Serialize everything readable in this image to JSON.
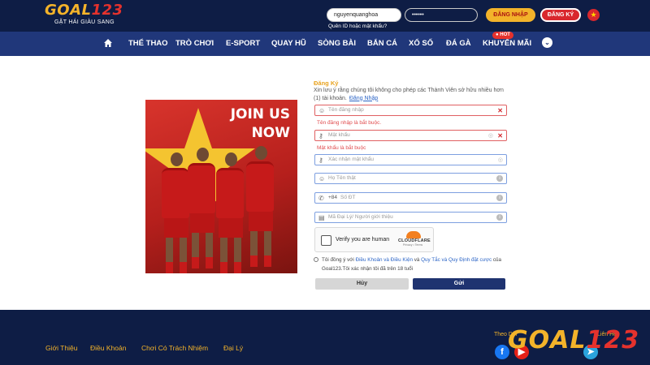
{
  "header": {
    "logo_text_a": "GOAL",
    "logo_text_b": "123",
    "logo_tagline": "GẶT HÁI GIÀU SANG",
    "username_value": "nguyenquanghoa",
    "password_value": "••••••",
    "forgot_label": "Quên ID hoặc mật khẩu?",
    "login_label": "ĐĂNG NHẬP",
    "register_label": "ĐĂNG KÝ",
    "flag_icon": "vietnam-flag-icon"
  },
  "nav": {
    "items": [
      {
        "label": "THỂ THAO"
      },
      {
        "label": "TRÒ CHƠI"
      },
      {
        "label": "E-SPORT"
      },
      {
        "label": "QUAY HŨ"
      },
      {
        "label": "SÒNG BÀI"
      },
      {
        "label": "BẮN CÁ"
      },
      {
        "label": "XỔ SỐ"
      },
      {
        "label": "ĐÁ GÀ"
      },
      {
        "label": "KHUYẾN MÃI"
      }
    ],
    "hot_badge": "HOT",
    "more_symbol": "⌄"
  },
  "banner": {
    "line1": "JOIN US",
    "line2": "NOW"
  },
  "form": {
    "title": "Đăng Ký",
    "notice": "Xin lưu ý rằng chúng tôi không cho phép các Thành Viên sở hữu nhiều hơn (1) tài khoản.",
    "notice_link": "Đăng Nhập",
    "username_placeholder": "Tên đăng nhập",
    "username_error": "Tên đăng nhập là bắt buộc.",
    "password_placeholder": "Mật khẩu",
    "password_error": "Mật khẩu là bắt buộc",
    "confirm_placeholder": "Xác nhận mật khẩu",
    "fullname_placeholder": "Họ Tên thật",
    "phone_code": "+84",
    "phone_placeholder": "Số ĐT",
    "referral_placeholder": "Mã Đại Lý/ Người giới thiệu",
    "captcha_label": "Verify you are human",
    "captcha_brand": "CLOUDFLARE",
    "captcha_links": "Privacy • Terms",
    "agree_prefix": "Tôi đồng ý với",
    "agree_link1": "Điều Khoản và Điều Kiện",
    "agree_mid": "và",
    "agree_link2": "Quy Tắc và Quy Định đặt cược",
    "agree_suffix": "của Goal123.Tôi xác nhận tôi đã trên 18 tuổi",
    "cancel_label": "Hủy",
    "submit_label": "Gửi"
  },
  "footer": {
    "links": [
      "Giới Thiệu",
      "Điều Khoản",
      "Chơi Có Trách Nhiệm",
      "Đại Lý"
    ],
    "follow_label": "Theo Dõi",
    "contact_label": "Liên Hệ",
    "logo_a": "GOAL",
    "logo_b": "123"
  },
  "colors": {
    "header_bg": "#0e1d45",
    "nav_bg": "#20377a",
    "accent_gold": "#f3b32a",
    "accent_red": "#d9272d",
    "submit_bg": "#1f3370"
  }
}
